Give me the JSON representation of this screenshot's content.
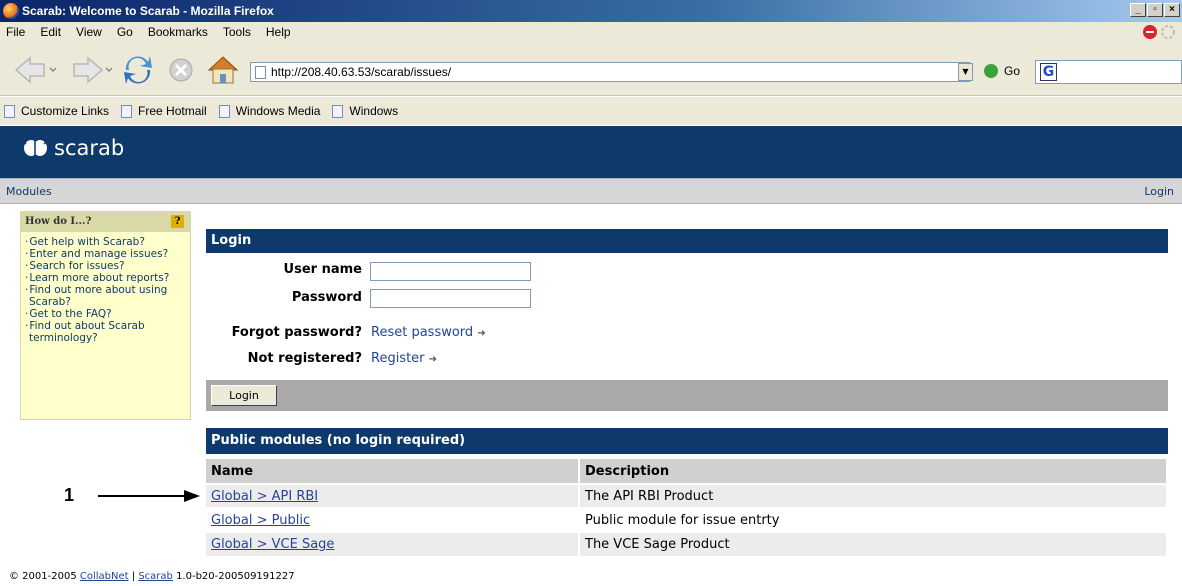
{
  "window": {
    "title": "Scarab: Welcome to Scarab - Mozilla Firefox"
  },
  "menu": [
    "File",
    "Edit",
    "View",
    "Go",
    "Bookmarks",
    "Tools",
    "Help"
  ],
  "nav": {
    "url": "http://208.40.63.53/scarab/issues/",
    "go_label": "Go"
  },
  "bookmarks": [
    "Customize Links",
    "Free Hotmail",
    "Windows Media",
    "Windows"
  ],
  "app": {
    "logo_text": "scarab",
    "brand_color": "#0e3a6b"
  },
  "navstrip": {
    "modules": "Modules",
    "login": "Login"
  },
  "help": {
    "title": "How do I...?",
    "items": [
      "Get help with Scarab?",
      "Enter and manage issues?",
      "Search for issues?",
      "Learn more about reports?",
      "Find out more about using Scarab?",
      "Get to the FAQ?",
      "Find out about Scarab terminology?"
    ]
  },
  "login": {
    "header": "Login",
    "username_label": "User name",
    "password_label": "Password",
    "forgot_label": "Forgot password?",
    "reset_link": "Reset password",
    "not_registered_label": "Not registered?",
    "register_link": "Register",
    "button": "Login"
  },
  "modules": {
    "header": "Public modules (no login required)",
    "columns": [
      "Name",
      "Description"
    ],
    "rows": [
      {
        "name": "Global > API RBI",
        "description": "The API RBI Product"
      },
      {
        "name": "Global > Public",
        "description": "Public module for issue entrty"
      },
      {
        "name": "Global > VCE Sage",
        "description": "The VCE Sage Product"
      }
    ]
  },
  "annotation": {
    "label": "1"
  },
  "footer": {
    "copyright": "© 2001-2005",
    "collabnet": "CollabNet",
    "separator": "|",
    "scarab": "Scarab",
    "version": "1.0-b20-200509191227"
  }
}
